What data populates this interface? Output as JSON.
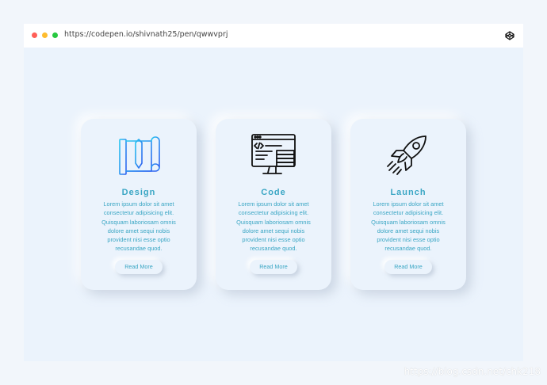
{
  "browser": {
    "url": "https://codepen.io/shivnath25/pen/qwwvprj",
    "icon": "codepen-icon"
  },
  "colors": {
    "accent": "#3aa6c4",
    "background": "#ebf3fc",
    "dot_red": "#ff5f57",
    "dot_yellow": "#febc2e",
    "dot_green": "#28c840"
  },
  "cards": [
    {
      "title": "Design",
      "icon": "blueprint-ruler-pencil-icon",
      "lines": [
        "Lorem ipsum dolor sit amet",
        "consectetur adipisicing elit.",
        "Quisquam laboriosam omnis",
        "dolore amet sequi nobis",
        "provident nisi esse optio",
        "recusandae quod."
      ],
      "button": "Read More"
    },
    {
      "title": "Code",
      "icon": "code-monitor-icon",
      "lines": [
        "Lorem ipsum dolor sit amet",
        "consectetur adipisicing elit.",
        "Quisquam laboriosam omnis",
        "dolore amet sequi nobis",
        "provident nisi esse optio",
        "recusandae quod."
      ],
      "button": "Read More"
    },
    {
      "title": "Launch",
      "icon": "rocket-icon",
      "lines": [
        "Lorem ipsum dolor sit amet",
        "consectetur adipisicing elit.",
        "Quisquam laboriosam omnis",
        "dolore amet sequi nobis",
        "provident nisi esse optio",
        "recusandae quod."
      ],
      "button": "Read More"
    }
  ],
  "watermark": "https://blog.csdn.net/chk218"
}
